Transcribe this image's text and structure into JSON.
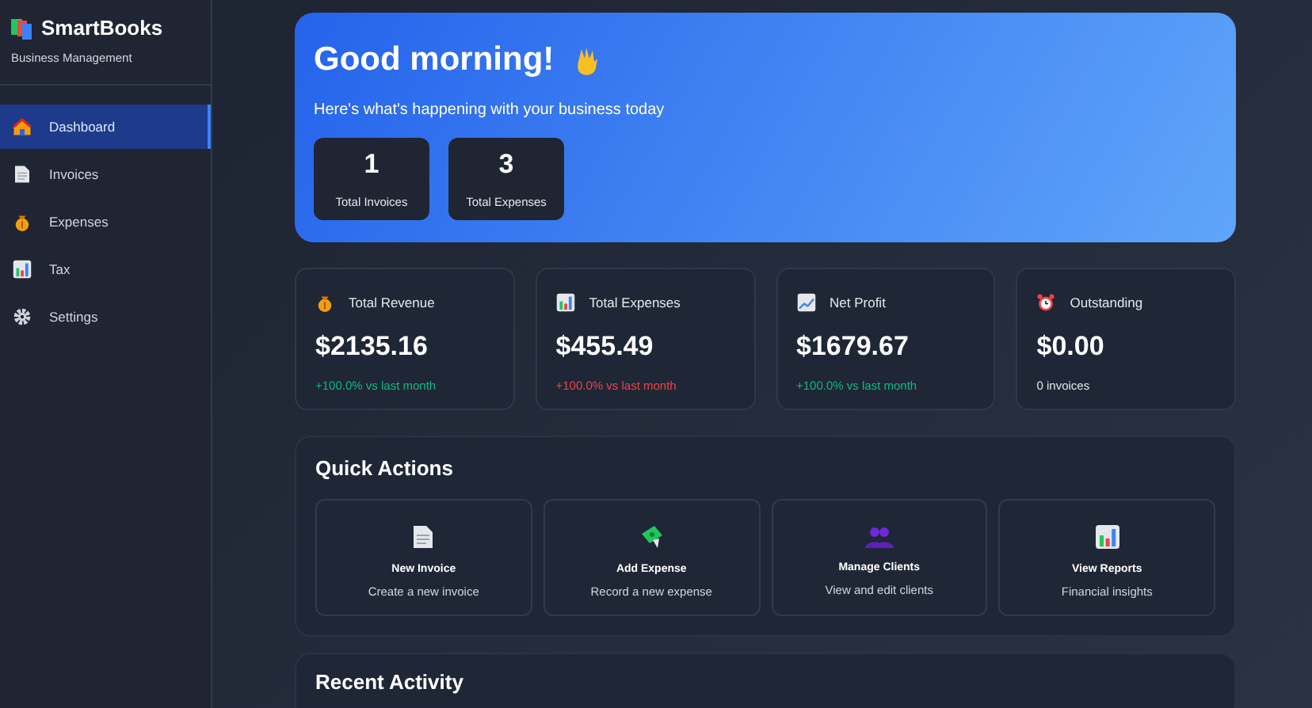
{
  "sidebar": {
    "brand": "SmartBooks",
    "tagline": "Business Management",
    "items": [
      {
        "label": "Dashboard",
        "selected": true
      },
      {
        "label": "Invoices",
        "selected": false
      },
      {
        "label": "Expenses",
        "selected": false
      },
      {
        "label": "Tax",
        "selected": false
      },
      {
        "label": "Settings",
        "selected": false
      }
    ]
  },
  "hero": {
    "greeting": "Good morning!",
    "subtitle": "Here's what's happening with your business today",
    "counters": [
      {
        "value": "1",
        "label": "Total Invoices"
      },
      {
        "value": "3",
        "label": "Total Expenses"
      }
    ]
  },
  "stats": [
    {
      "title": "Total Revenue",
      "value": "$2135.16",
      "note": "+100.0% vs last month",
      "color": "#10b981"
    },
    {
      "title": "Total Expenses",
      "value": "$455.49",
      "note": "+100.0% vs last month",
      "color": "#ef4444"
    },
    {
      "title": "Net Profit",
      "value": "$1679.67",
      "note": "+100.0% vs last month",
      "color": "#10b981"
    },
    {
      "title": "Outstanding",
      "value": "$0.00",
      "note": "0 invoices",
      "color": "#e5e7eb"
    }
  ],
  "quick_actions": {
    "title": "Quick Actions",
    "items": [
      {
        "title": "New Invoice",
        "description": "Create a new invoice"
      },
      {
        "title": "Add Expense",
        "description": "Record a new expense"
      },
      {
        "title": "Manage Clients",
        "description": "View and edit clients"
      },
      {
        "title": "View Reports",
        "description": "Financial insights"
      }
    ]
  },
  "recent_activity": {
    "title": "Recent Activity"
  }
}
